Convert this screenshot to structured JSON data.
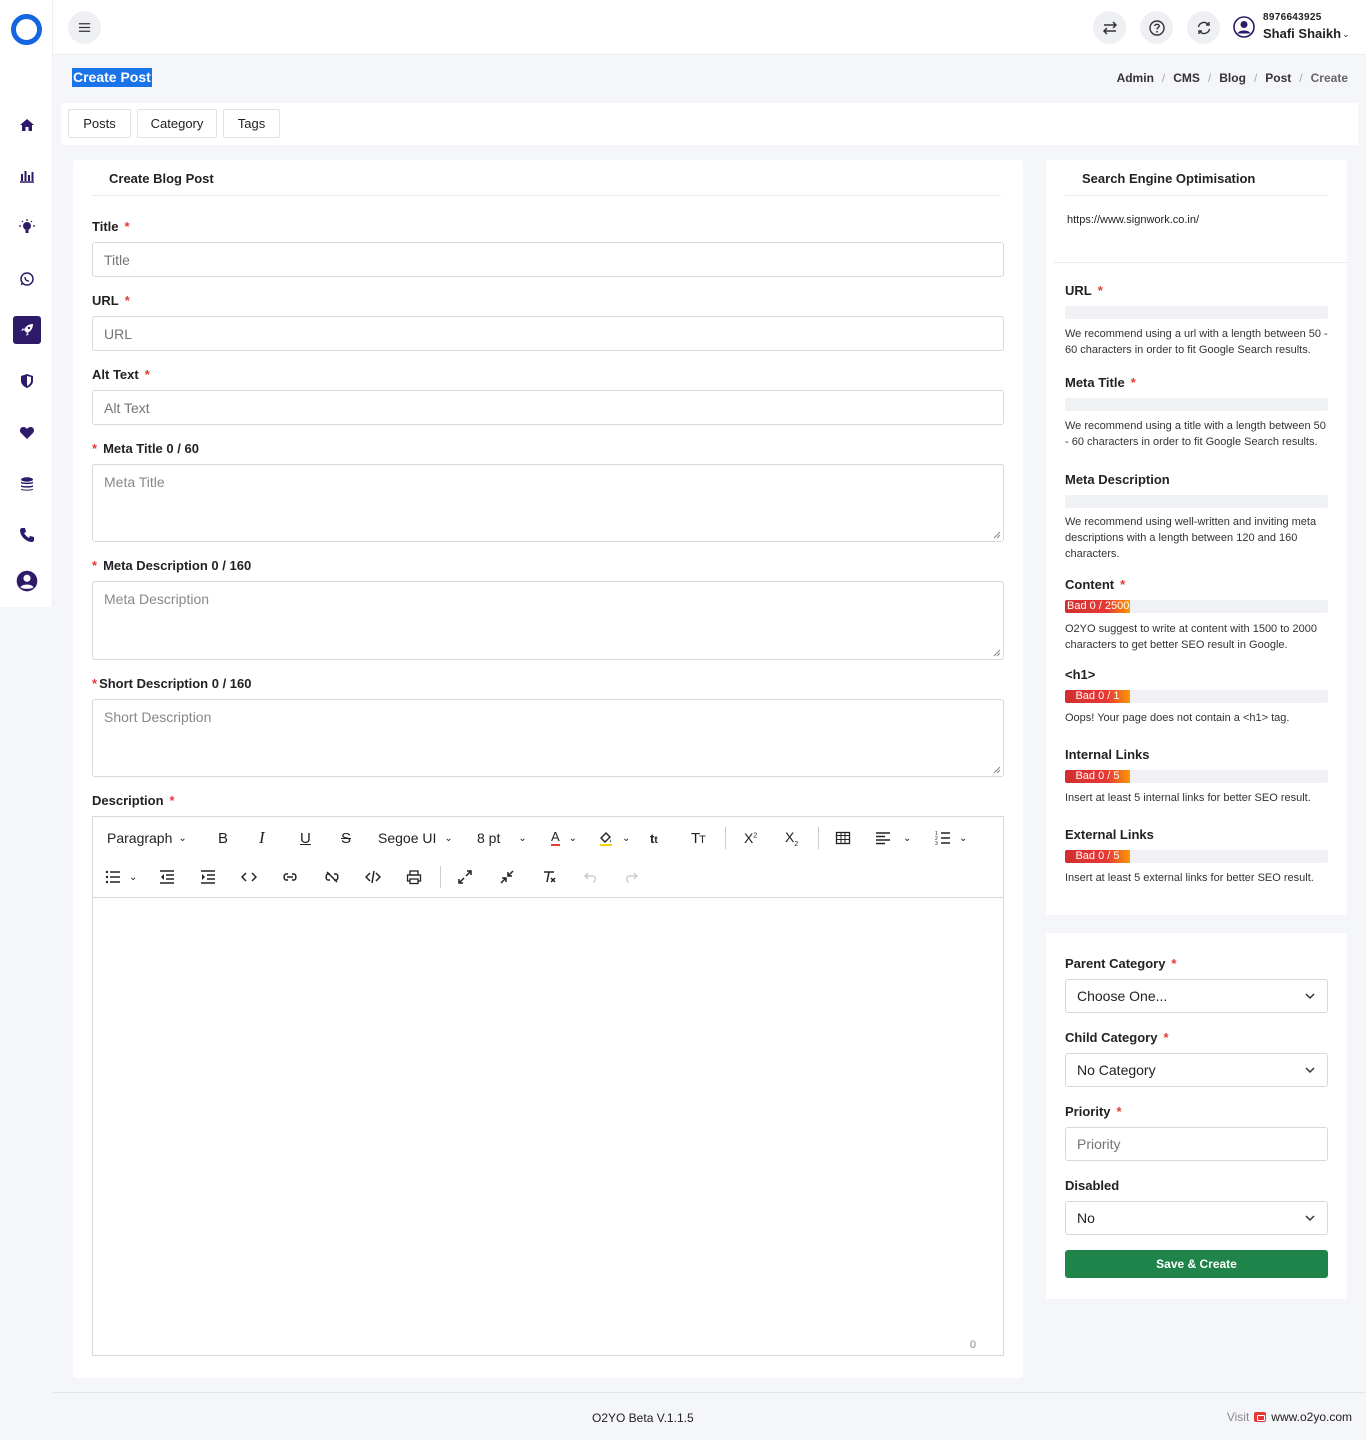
{
  "header": {
    "user_phone": "8976643925",
    "user_name": "Shafi Shaikh"
  },
  "page": {
    "title": "Create Post",
    "breadcrumb": [
      "Admin",
      "CMS",
      "Blog",
      "Post",
      "Create"
    ]
  },
  "tabs": [
    "Posts",
    "Category",
    "Tags"
  ],
  "form": {
    "card_title": "Create Blog Post",
    "title_label": "Title",
    "title_placeholder": "Title",
    "url_label": "URL",
    "url_placeholder": "URL",
    "alt_label": "Alt Text",
    "alt_placeholder": "Alt Text",
    "meta_title_label": "Meta Title 0 / 60",
    "meta_title_placeholder": "Meta Title",
    "meta_desc_label": "Meta Description 0 / 160",
    "meta_desc_placeholder": "Meta Description",
    "short_desc_label": "Short Description 0 / 160",
    "short_desc_placeholder": "Short Description",
    "description_label": "Description",
    "required_mark": "*"
  },
  "editor": {
    "block_format": "Paragraph",
    "font_family": "Segoe UI",
    "font_size": "8 pt",
    "char_count": "0"
  },
  "seo": {
    "card_title": "Search Engine Optimisation",
    "preview_url": "https://www.signwork.co.in/",
    "url_label": "URL",
    "url_note": "We recommend using a url with a length between 50 - 60 characters in order to fit Google Search results.",
    "meta_title_label": "Meta Title",
    "meta_title_note": "We recommend using a title with a length between 50 - 60 characters in order to fit Google Search results.",
    "meta_desc_label": "Meta Description",
    "meta_desc_note": "We recommend using well-written and inviting meta descriptions with a length between 120 and 160 characters.",
    "content_label": "Content",
    "content_badge": "Bad 0 / 2500",
    "content_note": "O2YO suggest to write at content with 1500 to 2000 characters to get better SEO result in Google.",
    "h1_label": "<h1>",
    "h1_badge": "Bad 0 / 1",
    "h1_note": "Oops! Your page does not contain a <h1> tag.",
    "internal_label": "Internal Links",
    "internal_badge": "Bad 0 / 5",
    "internal_note": "Insert at least 5 internal links for better SEO result.",
    "external_label": "External Links",
    "external_badge": "Bad 0 / 5",
    "external_note": "Insert at least 5 external links for better SEO result."
  },
  "category": {
    "parent_label": "Parent Category",
    "parent_value": "Choose One...",
    "child_label": "Child Category",
    "child_value": "No Category",
    "priority_label": "Priority",
    "priority_placeholder": "Priority",
    "disabled_label": "Disabled",
    "disabled_value": "No",
    "save_button": "Save & Create"
  },
  "footer": {
    "version": "O2YO Beta V.1.1.5",
    "visit_label": "Visit",
    "visit_url": "www.o2yo.com"
  },
  "colors": {
    "accent": "#1a73e8",
    "sidebar_active": "#2d1b69",
    "save_button": "#1e8449",
    "bad_badge": "#e53935",
    "required": "#e53935"
  }
}
